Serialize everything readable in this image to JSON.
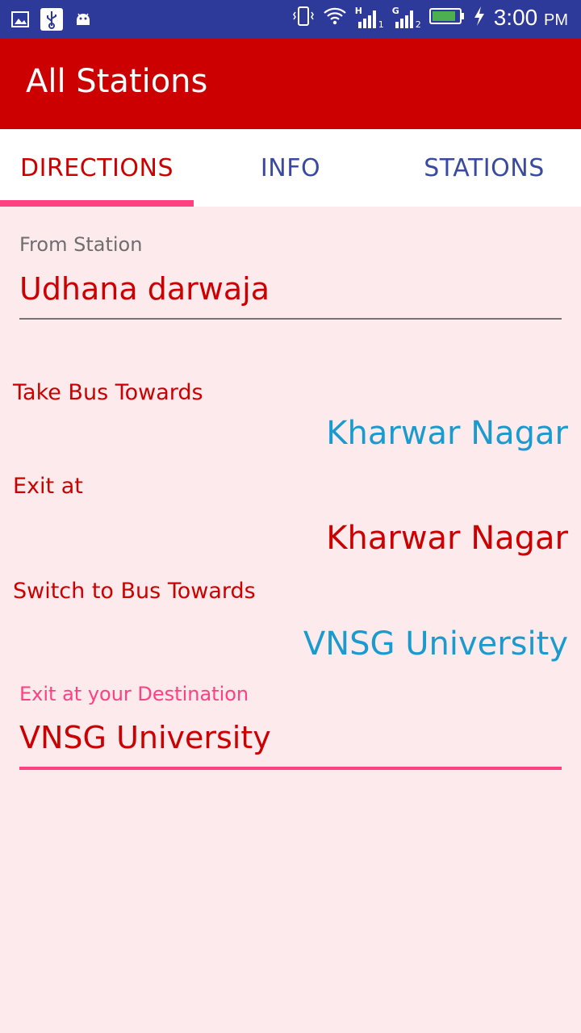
{
  "status_bar": {
    "time": "3:00",
    "ampm": "PM",
    "left_icons": [
      "image-icon",
      "usb-icon",
      "android-debug-icon"
    ],
    "right_icons": [
      "vibrate-icon",
      "wifi-icon",
      "signal-sim1-icon",
      "signal-sim2-icon",
      "battery-icon",
      "charging-icon"
    ],
    "sim1_network": "H",
    "sim1_index": "1",
    "sim2_network": "G",
    "sim2_index": "2"
  },
  "app_bar": {
    "title": "All Stations"
  },
  "tabs": [
    {
      "label": "DIRECTIONS",
      "active": true
    },
    {
      "label": "INFO",
      "active": false
    },
    {
      "label": "STATIONS",
      "active": false
    }
  ],
  "directions": {
    "from_label": "From Station",
    "from_value": "Udhana darwaja",
    "take_bus_label": "Take Bus Towards",
    "take_bus_value": "Kharwar Nagar",
    "exit_label": "Exit at",
    "exit_value": "Kharwar Nagar",
    "switch_label": "Switch to Bus Towards",
    "switch_value": "VNSG University",
    "destination_label": "Exit at your Destination",
    "destination_value": "VNSG University"
  },
  "colors": {
    "status_bar": "#2e3a9a",
    "app_bar": "#cc0000",
    "accent_pink": "#ff4081",
    "blue_value": "#1a9bd0",
    "background": "#fdeaec"
  }
}
